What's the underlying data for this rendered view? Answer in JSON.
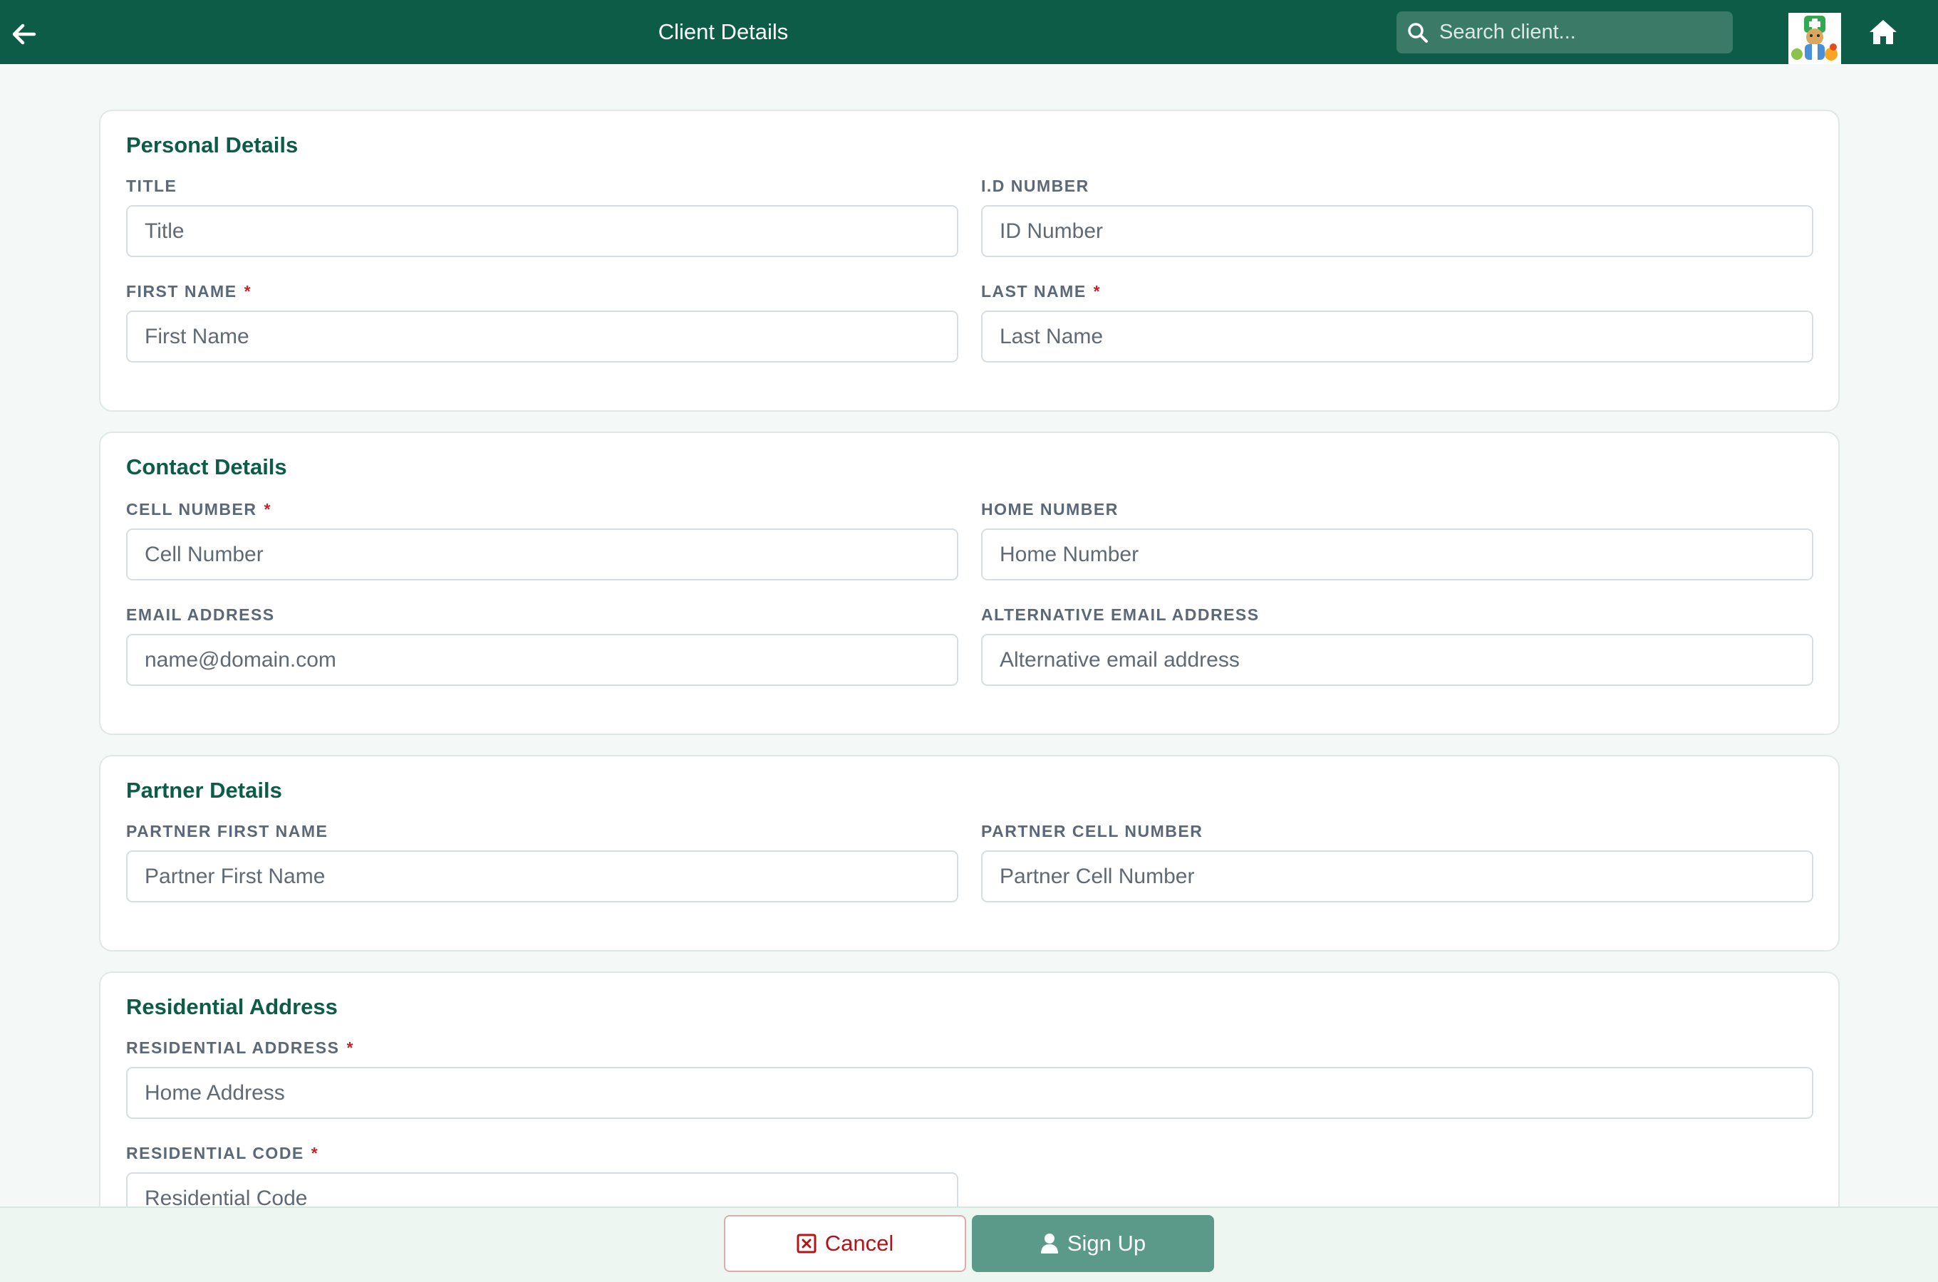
{
  "header": {
    "title": "Client Details",
    "search_placeholder": "Search client..."
  },
  "sections": {
    "personal": {
      "title": "Personal Details",
      "title_label": "TITLE",
      "title_placeholder": "Title",
      "id_label": "I.D NUMBER",
      "id_placeholder": "ID Number",
      "first_name_label": "FIRST NAME",
      "first_name_placeholder": "First Name",
      "last_name_label": "LAST NAME",
      "last_name_placeholder": "Last Name"
    },
    "contact": {
      "title": "Contact Details",
      "cell_label": "CELL NUMBER",
      "cell_placeholder": "Cell Number",
      "home_label": "HOME NUMBER",
      "home_placeholder": "Home Number",
      "email_label": "EMAIL ADDRESS",
      "email_placeholder": "name@domain.com",
      "alt_email_label": "ALTERNATIVE EMAIL ADDRESS",
      "alt_email_placeholder": "Alternative email address"
    },
    "partner": {
      "title": "Partner Details",
      "first_name_label": "PARTNER FIRST NAME",
      "first_name_placeholder": "Partner First Name",
      "cell_label": "PARTNER CELL NUMBER",
      "cell_placeholder": "Partner Cell Number"
    },
    "residential": {
      "title": "Residential Address",
      "address_label": "RESIDENTIAL ADDRESS",
      "address_placeholder": "Home Address",
      "code_label": "RESIDENTIAL CODE",
      "code_placeholder": "Residential Code"
    }
  },
  "required_marker": "*",
  "footer": {
    "cancel_label": "Cancel",
    "signup_label": "Sign Up"
  },
  "colors": {
    "brand": "#0d5c47",
    "required": "#c0262d",
    "signup_button": "#5b9a88",
    "cancel_text": "#b3141b"
  },
  "icons": {
    "back": "arrow-left-icon",
    "search": "search-icon",
    "home": "home-icon",
    "cancel": "close-box-icon",
    "signup": "user-icon"
  }
}
